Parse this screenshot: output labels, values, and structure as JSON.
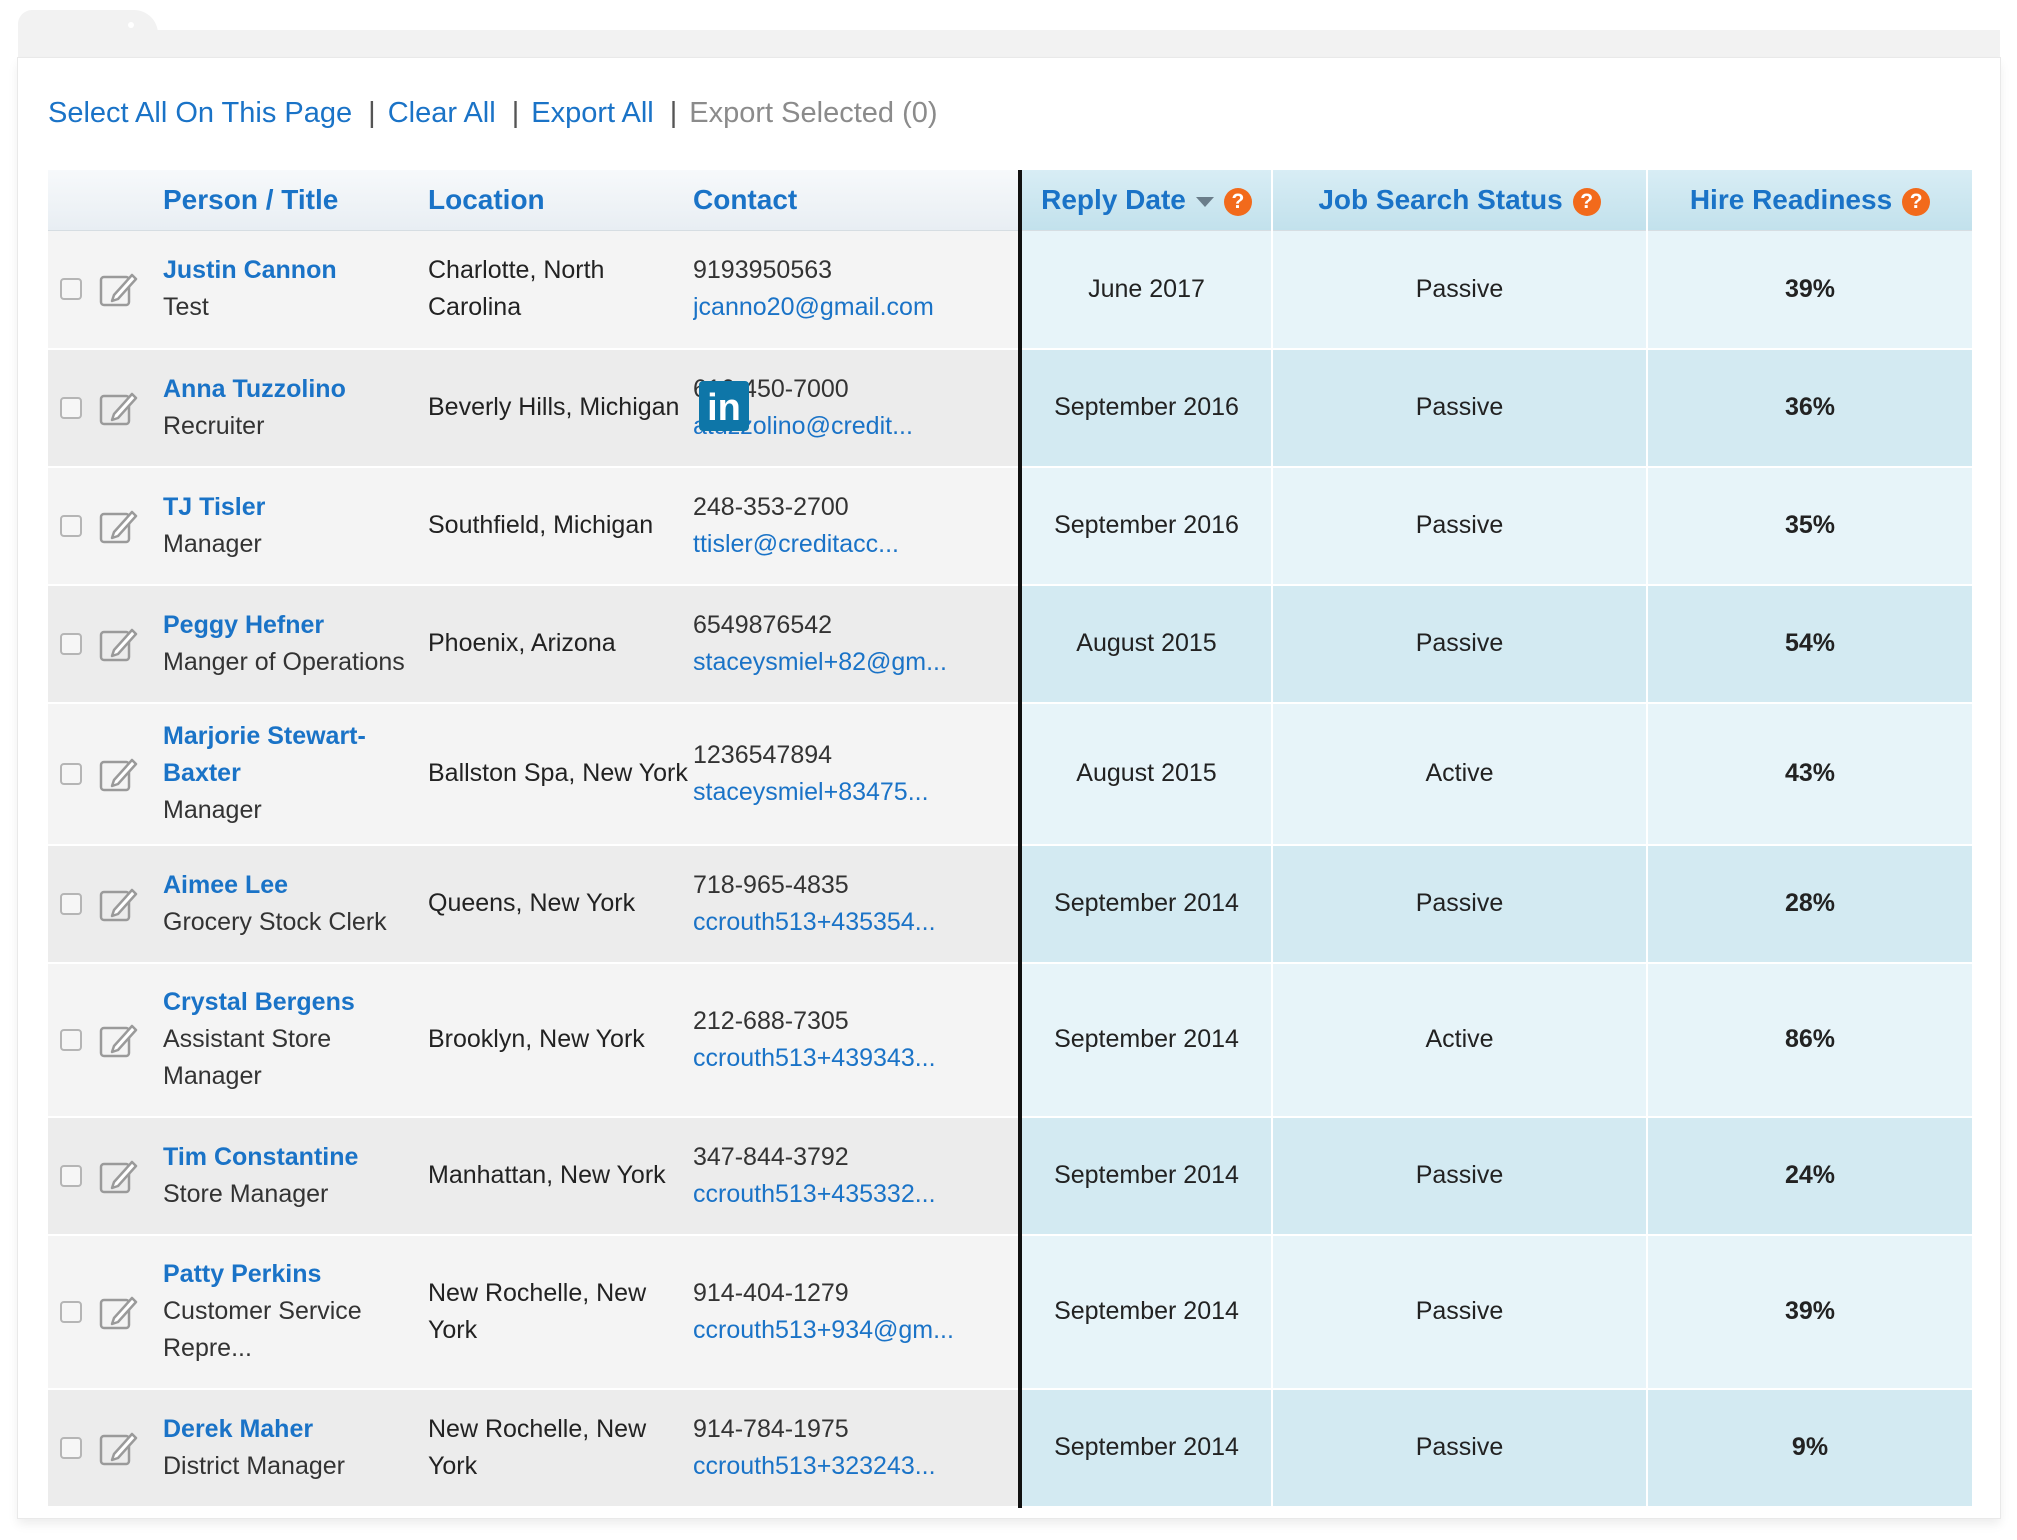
{
  "actions": {
    "select_all": "Select All On This Page",
    "clear_all": "Clear All",
    "export_all": "Export All",
    "export_selected": "Export Selected (0)",
    "separator": "|"
  },
  "columns": {
    "person": "Person / Title",
    "location": "Location",
    "contact": "Contact",
    "reply_date": "Reply Date",
    "job_search_status": "Job Search Status",
    "hire_readiness": "Hire Readiness",
    "help_glyph": "?"
  },
  "linkedin_glyph": "in",
  "rows": [
    {
      "name": "Justin Cannon",
      "title": "Test",
      "location": "Charlotte, North Carolina",
      "phone": "9193950563",
      "email": "jcanno20@gmail.com",
      "reply": "June 2017",
      "status": "Passive",
      "readiness": "39%"
    },
    {
      "name": "Anna Tuzzolino",
      "title": "Recruiter",
      "location": "Beverly Hills, Michigan",
      "phone": "616-450-7000",
      "email": "atuzzolino@credit...",
      "reply": "September 2016",
      "status": "Passive",
      "readiness": "36%"
    },
    {
      "name": "TJ Tisler",
      "title": "Manager",
      "location": "Southfield, Michigan",
      "phone": "248-353-2700",
      "email": "ttisler@creditacc...",
      "reply": "September 2016",
      "status": "Passive",
      "readiness": "35%"
    },
    {
      "name": "Peggy Hefner",
      "title": "Manger of Operations",
      "location": "Phoenix, Arizona",
      "phone": "6549876542",
      "email": "staceysmiel+82@gm...",
      "reply": "August 2015",
      "status": "Passive",
      "readiness": "54%"
    },
    {
      "name": "Marjorie Stewart-Baxter",
      "title": "Manager",
      "location": "Ballston Spa, New York",
      "phone": "1236547894",
      "email": "staceysmiel+83475...",
      "reply": "August 2015",
      "status": "Active",
      "readiness": "43%"
    },
    {
      "name": "Aimee Lee",
      "title": "Grocery Stock Clerk",
      "location": "Queens, New York",
      "phone": "718-965-4835",
      "email": "ccrouth513+435354...",
      "reply": "September 2014",
      "status": "Passive",
      "readiness": "28%"
    },
    {
      "name": "Crystal Bergens",
      "title": "Assistant Store Manager",
      "location": "Brooklyn, New York",
      "phone": "212-688-7305",
      "email": "ccrouth513+439343...",
      "reply": "September 2014",
      "status": "Active",
      "readiness": "86%"
    },
    {
      "name": "Tim Constantine",
      "title": "Store Manager",
      "location": "Manhattan, New York",
      "phone": "347-844-3792",
      "email": "ccrouth513+435332...",
      "reply": "September 2014",
      "status": "Passive",
      "readiness": "24%"
    },
    {
      "name": "Patty Perkins",
      "title": "Customer Service Repre...",
      "location": "New Rochelle, New York",
      "phone": "914-404-1279",
      "email": "ccrouth513+934@gm...",
      "reply": "September 2014",
      "status": "Passive",
      "readiness": "39%"
    },
    {
      "name": "Derek Maher",
      "title": "District Manager",
      "location": "New Rochelle, New York",
      "phone": "914-784-1975",
      "email": "ccrouth513+323243...",
      "reply": "September 2014",
      "status": "Passive",
      "readiness": "9%"
    }
  ]
}
